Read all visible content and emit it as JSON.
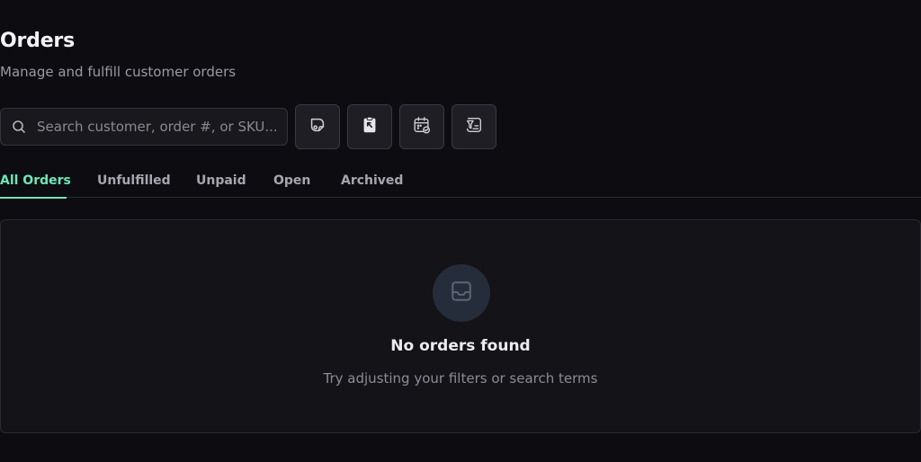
{
  "header": {
    "title": "Orders",
    "subtitle": "Manage and fulfill customer orders"
  },
  "search": {
    "placeholder": "Search customer, order #, or SKU...",
    "value": "",
    "icon": "search-icon"
  },
  "toolbar": {
    "buttons": [
      {
        "icon": "sticker-icon"
      },
      {
        "icon": "clipboard-cursor-icon"
      },
      {
        "icon": "calendar-check-icon"
      },
      {
        "icon": "filter-list-icon"
      }
    ]
  },
  "tabs": [
    {
      "label": "All Orders",
      "active": true
    },
    {
      "label": "Unfulfilled",
      "active": false
    },
    {
      "label": "Unpaid",
      "active": false
    },
    {
      "label": "Open",
      "active": false
    },
    {
      "label": "Archived",
      "active": false
    }
  ],
  "empty_state": {
    "icon": "inbox-icon",
    "title": "No orders found",
    "message": "Try adjusting your filters or search terms"
  },
  "colors": {
    "background": "#0d0d11",
    "accent": "#6ee7b7",
    "card": "#131318"
  }
}
